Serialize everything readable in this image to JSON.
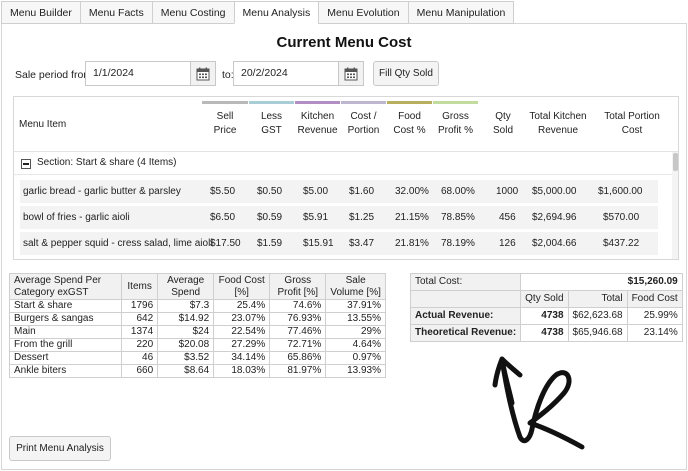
{
  "tabs": [
    {
      "label": "Menu Builder"
    },
    {
      "label": "Menu Facts"
    },
    {
      "label": "Menu Costing"
    },
    {
      "label": "Menu Analysis"
    },
    {
      "label": "Menu Evolution"
    },
    {
      "label": "Menu Manipulation"
    }
  ],
  "active_tab": "Menu Analysis",
  "title": "Current Menu Cost",
  "sale_period": {
    "label": "Sale period from:",
    "from": "1/1/2024",
    "to_label": "to:",
    "to": "20/2/2024",
    "fill_button": "Fill Qty Sold"
  },
  "colors": {
    "bar_grey": "#b9b9b9",
    "bar_teal": "#a9cdd4",
    "bar_purple": "#b38ec4",
    "bar_lavender": "#bdb6cf",
    "bar_olive": "#b7ae60",
    "bar_green": "#c2db9e"
  },
  "grid": {
    "headers": {
      "menu_item": "Menu Item",
      "sell_price": [
        "Sell",
        "Price"
      ],
      "less_gst": [
        "Less",
        "GST"
      ],
      "kitchen_revenue": [
        "Kitchen",
        "Revenue"
      ],
      "cost_portion": [
        "Cost /",
        "Portion"
      ],
      "food_cost": [
        "Food",
        "Cost %"
      ],
      "gross_profit": [
        "Gross",
        "Profit %"
      ],
      "qty_sold": [
        "Qty",
        "Sold"
      ],
      "total_kitchen_revenue": [
        "Total Kitchen",
        "Revenue"
      ],
      "total_portion_cost": [
        "Total Portion",
        "Cost"
      ]
    },
    "section": "Section: Start & share (4 Items)",
    "rows": [
      {
        "item": "garlic bread - garlic butter & parsley",
        "sell": "$5.50",
        "gst": "$0.50",
        "kitchen": "$5.00",
        "cost": "$1.60",
        "food": "32.00%",
        "gross": "68.00%",
        "qty": "1000",
        "total_rev": "$5,000.00",
        "total_cost": "$1,600.00"
      },
      {
        "item": "bowl of fries - garlic aioli",
        "sell": "$6.50",
        "gst": "$0.59",
        "kitchen": "$5.91",
        "cost": "$1.25",
        "food": "21.15%",
        "gross": "78.85%",
        "qty": "456",
        "total_rev": "$2,694.96",
        "total_cost": "$570.00"
      },
      {
        "item": "salt & pepper squid - cress salad, lime aioli",
        "sell": "$17.50",
        "gst": "$1.59",
        "kitchen": "$15.91",
        "cost": "$3.47",
        "food": "21.81%",
        "gross": "78.19%",
        "qty": "126",
        "total_rev": "$2,004.66",
        "total_cost": "$437.22"
      }
    ]
  },
  "category_table": {
    "headers": [
      "Average Spend Per Category exGST",
      "Items",
      "Average Spend",
      "Food Cost [%]",
      "Gross Profit [%]",
      "Sale Volume [%]"
    ],
    "header_lines": [
      [
        "Average Spend Per",
        "Category exGST"
      ],
      [
        "Items"
      ],
      [
        "Average",
        "Spend"
      ],
      [
        "Food Cost",
        "[%]"
      ],
      [
        "Gross",
        "Profit [%]"
      ],
      [
        "Sale",
        "Volume [%]"
      ]
    ],
    "rows": [
      [
        "Start & share",
        "1796",
        "$7.3",
        "25.4%",
        "74.6%",
        "37.91%"
      ],
      [
        "Burgers & sangas",
        "642",
        "$14.92",
        "23.07%",
        "76.93%",
        "13.55%"
      ],
      [
        "Main",
        "1374",
        "$24",
        "22.54%",
        "77.46%",
        "29%"
      ],
      [
        "From the grill",
        "220",
        "$20.08",
        "27.29%",
        "72.71%",
        "4.64%"
      ],
      [
        "Dessert",
        "46",
        "$3.52",
        "34.14%",
        "65.86%",
        "0.97%"
      ],
      [
        "Ankle biters",
        "660",
        "$8.64",
        "18.03%",
        "81.97%",
        "13.93%"
      ]
    ]
  },
  "summary": {
    "total_cost_label": "Total Cost:",
    "total_cost": "$15,260.09",
    "col_qty": "Qty Sold",
    "col_total": "Total",
    "col_food": "Food Cost",
    "actual_label": "Actual Revenue:",
    "actual_qty": "4738",
    "actual_total": "$62,623.68",
    "actual_food": "25.99%",
    "theoretical_label": "Theoretical Revenue:",
    "theoretical_qty": "4738",
    "theoretical_total": "$65,946.68",
    "theoretical_food": "23.14%"
  },
  "print_button": "Print Menu Analysis"
}
